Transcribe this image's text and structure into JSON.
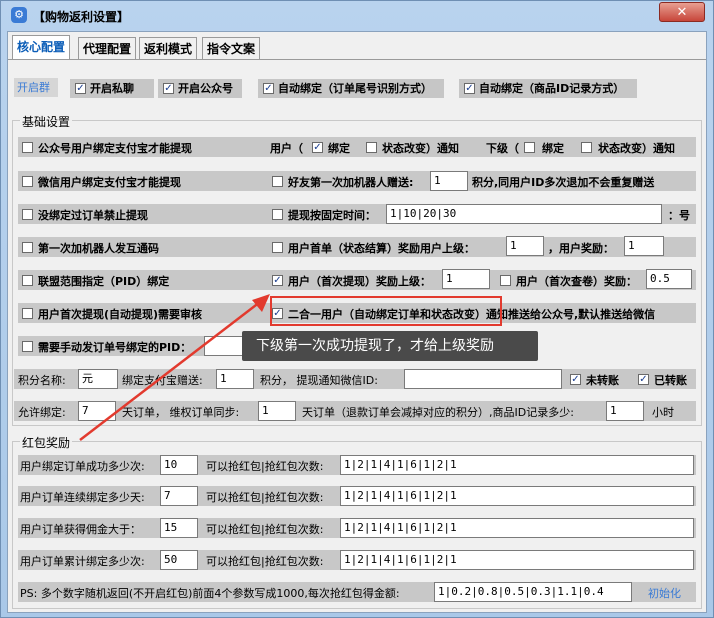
{
  "window": {
    "title": "【购物返利设置】",
    "close": "✕"
  },
  "tabs": [
    "核心配置",
    "代理配置",
    "返利模式",
    "指令文案"
  ],
  "top_options": {
    "open_group": "开启群",
    "open_private": "开启私聊",
    "open_official": "开启公众号",
    "auto_bind_order": "自动绑定（订单尾号识别方式）",
    "auto_bind_goods": "自动绑定（商品ID记录方式）"
  },
  "basic": {
    "legend": "基础设置",
    "official_alipay": "公众号用户绑定支付宝才能提现",
    "user_status_prefix": "用户（",
    "bind": "绑定",
    "status_change_notify": "状态改变）通知",
    "sub_prefix": "下级（",
    "bind2": "绑定",
    "status_change_notify2": "状态改变）通知",
    "wechat_alipay": "微信用户绑定支付宝才能提现",
    "friend_gift": "好友第一次加机器人赠送:",
    "friend_gift_value": "1",
    "friend_gift_suffix": "积分,同用户ID多次退加不会重复赠送",
    "no_bind_block": "没绑定过订单禁止提现",
    "fixed_time": "提现按固定时间：",
    "fixed_time_value": "1|10|20|30",
    "day_suffix": "：号",
    "first_add_code": "第一次加机器人发互通码",
    "first_order": "用户首单（状态结算）奖励用户上级：",
    "first_order_value": "1",
    "user_reward": "，用户奖励：",
    "user_reward_value": "1",
    "pid_bind": "联盟范围指定（PID）绑定",
    "first_withdraw": "用户（首次提现）奖励上级：",
    "first_withdraw_value": "1",
    "first_check": "用户（首次查卷）奖励：",
    "first_check_value": "0.5",
    "first_review": "用户首次提现(自动提现)需要审核",
    "two_in_one": "二合一用户（自动绑定订单和状态改变）通知推送给公众号,默认推送给微信",
    "manual_send": "需要手动发订单号绑定的PID：",
    "points_name": "积分名称:",
    "points_name_value": "元",
    "bind_alipay_gift": "绑定支付宝赠送:",
    "bind_alipay_gift_value": "1",
    "points_notify": "积分， 提现通知微信ID:",
    "points_notify_value": "",
    "not_transfer": "未转账",
    "transferred": "已转账",
    "allow_bind": "允许绑定:",
    "allow_bind_value": "7",
    "days_sync": "天订单， 维权订单同步:",
    "days_sync_value": "1",
    "days_refund": "天订单（退款订单会减掉对应的积分）,商品ID记录多少:",
    "days_refund_value": "1",
    "hours": "小时"
  },
  "redpacket": {
    "legend": "红包奖励",
    "rows": [
      {
        "label": "用户绑定订单成功多少次:",
        "value": "10",
        "times_label": "可以抢红包|抢红包次数:",
        "times": "1|2|1|4|1|6|1|2|1"
      },
      {
        "label": "用户订单连续绑定多少天:",
        "value": "7",
        "times_label": "可以抢红包|抢红包次数:",
        "times": "1|2|1|4|1|6|1|2|1"
      },
      {
        "label": "用户订单获得佣金大于：",
        "value": "15",
        "times_label": "可以抢红包|抢红包次数:",
        "times": "1|2|1|4|1|6|1|2|1"
      },
      {
        "label": "用户订单累计绑定多少次:",
        "value": "50",
        "times_label": "可以抢红包|抢红包次数:",
        "times": "1|2|1|4|1|6|1|2|1"
      }
    ],
    "ps": "PS: 多个数字随机返回(不开启红包)前面4个参数写成1000,每次抢红包得金额:",
    "ps_value": "1|0.2|0.8|0.5|0.3|1.1|0.4",
    "init": "初始化"
  },
  "annotation": "下级第一次成功提现了，才给上级奖励"
}
